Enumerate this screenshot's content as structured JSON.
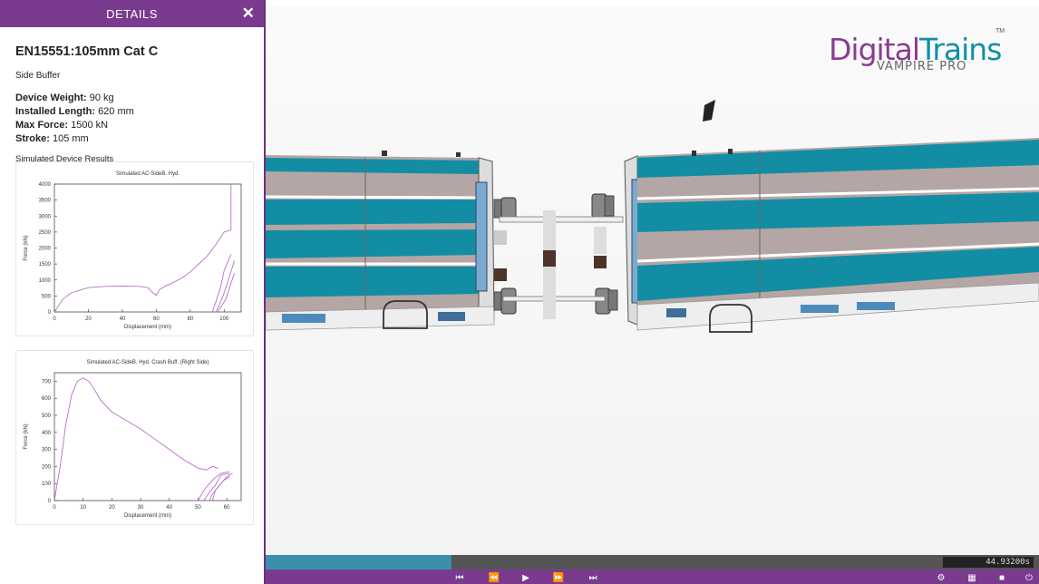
{
  "sidebar": {
    "header": "DETAILS",
    "close_glyph": "✕",
    "device_title": "EN15551:105mm Cat C",
    "device_type": "Side Buffer",
    "properties": [
      {
        "label": "Device Weight:",
        "value": "90 kg"
      },
      {
        "label": "Installed Length:",
        "value": "620 mm"
      },
      {
        "label": "Max Force:",
        "value": "1500 kN"
      },
      {
        "label": "Stroke:",
        "value": "105 mm"
      }
    ],
    "results_heading": "Simulated Device Results"
  },
  "chart_data": [
    {
      "type": "line",
      "title": "Simulated AC-SideB. Hyd.",
      "xlabel": "Displacement (mm)",
      "ylabel": "Force (kN)",
      "xlim": [
        0,
        110
      ],
      "ylim": [
        0,
        4000
      ],
      "xticks": [
        0,
        20,
        40,
        60,
        80,
        100
      ],
      "yticks": [
        0,
        500,
        1000,
        1500,
        2000,
        2500,
        3000,
        3500,
        4000
      ],
      "color": "#b96fc7",
      "series": [
        {
          "x": [
            0,
            5,
            10,
            20,
            30,
            40,
            50,
            55,
            58,
            60,
            62,
            65,
            70,
            75,
            80,
            85,
            90,
            95,
            100,
            104
          ],
          "y": [
            0,
            400,
            600,
            760,
            800,
            810,
            800,
            760,
            600,
            520,
            700,
            800,
            920,
            1060,
            1250,
            1500,
            1750,
            2100,
            2500,
            2560
          ]
        },
        {
          "x": [
            104,
            104,
            104
          ],
          "y": [
            2560,
            3400,
            4000
          ]
        },
        {
          "x": [
            93,
            95,
            98,
            100,
            104
          ],
          "y": [
            0,
            300,
            800,
            1300,
            1800
          ]
        },
        {
          "x": [
            95,
            97,
            100,
            103,
            106
          ],
          "y": [
            0,
            200,
            600,
            1100,
            1600
          ]
        },
        {
          "x": [
            96,
            98,
            101,
            104,
            106
          ],
          "y": [
            0,
            150,
            400,
            900,
            1200
          ]
        }
      ]
    },
    {
      "type": "line",
      "title": "Simulated AC-SideB. Hyd. Crash Buff. (Right Side)",
      "xlabel": "Displacement (mm)",
      "ylabel": "Force (kN)",
      "xlim": [
        0,
        65
      ],
      "ylim": [
        0,
        750
      ],
      "xticks": [
        0,
        10,
        20,
        30,
        40,
        50,
        60
      ],
      "yticks": [
        0,
        100,
        200,
        300,
        400,
        500,
        600,
        700
      ],
      "color": "#b96fc7",
      "series": [
        {
          "x": [
            0,
            2,
            4,
            6,
            8,
            10,
            12,
            14,
            16,
            20,
            25,
            30,
            35,
            40,
            45,
            50,
            53,
            55,
            57
          ],
          "y": [
            0,
            200,
            450,
            620,
            700,
            720,
            700,
            650,
            590,
            520,
            470,
            420,
            360,
            300,
            240,
            190,
            180,
            200,
            190
          ]
        },
        {
          "x": [
            50,
            52,
            55,
            58,
            61
          ],
          "y": [
            0,
            60,
            120,
            160,
            170
          ]
        },
        {
          "x": [
            52,
            54,
            56,
            58,
            61
          ],
          "y": [
            0,
            50,
            90,
            150,
            160
          ]
        },
        {
          "x": [
            54,
            55,
            57,
            59,
            61
          ],
          "y": [
            0,
            40,
            80,
            120,
            140
          ]
        },
        {
          "x": [
            55,
            56,
            58,
            60,
            62
          ],
          "y": [
            0,
            60,
            100,
            140,
            160
          ]
        }
      ]
    }
  ],
  "logo": {
    "word1": "Digital",
    "word2": "Trains",
    "tm": "TM",
    "subtitle": "VAMPIRE PRO"
  },
  "playback": {
    "time": "44.93200s",
    "progress": 0.24
  },
  "controls": {
    "skip_back": "⏮",
    "rewind": "⏪",
    "play": "▶",
    "fast_forward": "⏩",
    "skip_forward": "⏭",
    "settings": "⚙",
    "table": "▦",
    "camera": "■",
    "power": "⏻"
  },
  "colors": {
    "accent": "#7a3b8f",
    "teal": "#138da3",
    "train_grey": "#b4a6a4"
  }
}
